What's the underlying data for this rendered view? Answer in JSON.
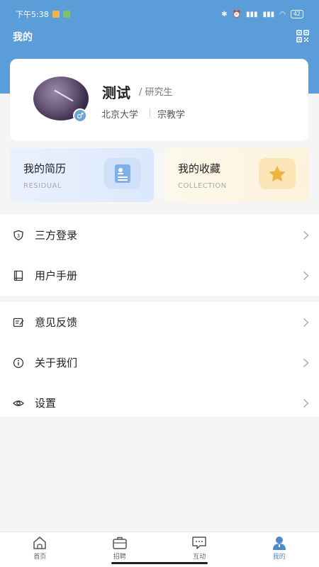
{
  "status_bar": {
    "time": "下午5:38",
    "battery": "42"
  },
  "header": {
    "title": "我的",
    "qr_icon": "qrcode-icon"
  },
  "profile": {
    "name": "测试",
    "degree": "/ 研究生",
    "school": "北京大学",
    "major": "宗教学",
    "gender_symbol": "♂"
  },
  "quick_cards": {
    "resume": {
      "title": "我的简历",
      "subtitle": "RESIDUAL",
      "icon": "resume-icon"
    },
    "favorites": {
      "title": "我的收藏",
      "subtitle": "COLLECTION",
      "icon": "star-icon"
    }
  },
  "menu": {
    "group1": [
      {
        "label": "三方登录",
        "icon": "shield-icon"
      },
      {
        "label": "用户手册",
        "icon": "book-icon"
      }
    ],
    "group2": [
      {
        "label": "意见反馈",
        "icon": "edit-icon"
      },
      {
        "label": "关于我们",
        "icon": "info-icon"
      },
      {
        "label": "设置",
        "icon": "eye-icon"
      }
    ]
  },
  "bottom_nav": [
    {
      "label": "首页",
      "icon": "home-icon"
    },
    {
      "label": "招聘",
      "icon": "briefcase-icon"
    },
    {
      "label": "互动",
      "icon": "chat-icon"
    },
    {
      "label": "我的",
      "icon": "user-icon",
      "active": true
    }
  ],
  "colors": {
    "header": "#5b9dd9",
    "accent": "#4a8bc7"
  }
}
